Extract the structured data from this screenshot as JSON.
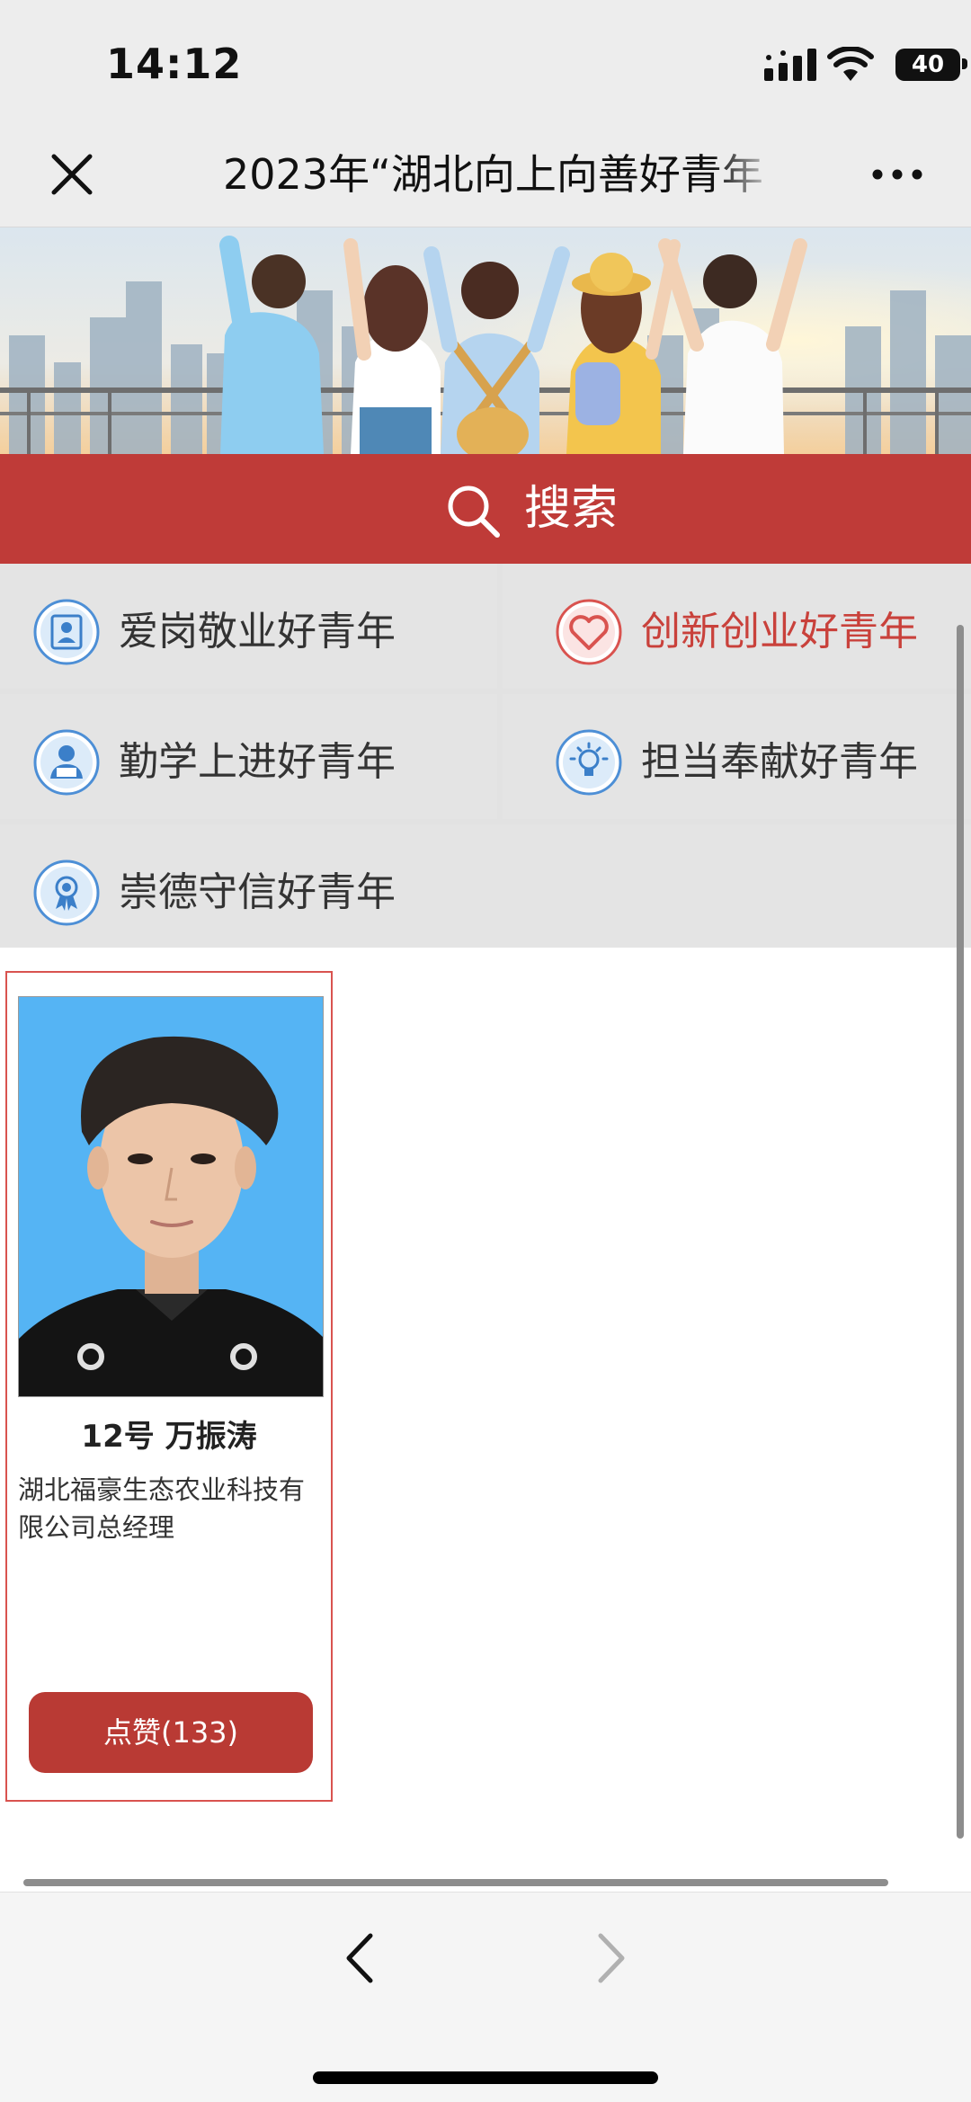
{
  "status_bar": {
    "time": "14:12",
    "battery": "40"
  },
  "nav": {
    "title": "2023年“湖北向上向善好青年"
  },
  "search": {
    "label": "搜索"
  },
  "categories": [
    {
      "label": "爱岗敬业好青年",
      "icon": "id-card-icon",
      "active": false
    },
    {
      "label": "创新创业好青年",
      "icon": "heart-icon",
      "active": true
    },
    {
      "label": "勤学上进好青年",
      "icon": "student-icon",
      "active": false
    },
    {
      "label": "担当奉献好青年",
      "icon": "lightbulb-icon",
      "active": false
    },
    {
      "label": "崇德守信好青年",
      "icon": "medal-icon",
      "active": false
    }
  ],
  "candidate": {
    "name": "12号  万振涛",
    "desc": "湖北福豪生态农业科技有限公司总经理",
    "like_label": "点赞(133)"
  },
  "colors": {
    "accent": "#bf3b38",
    "active_text": "#c9413b",
    "photo_bg": "#55b4f4"
  }
}
